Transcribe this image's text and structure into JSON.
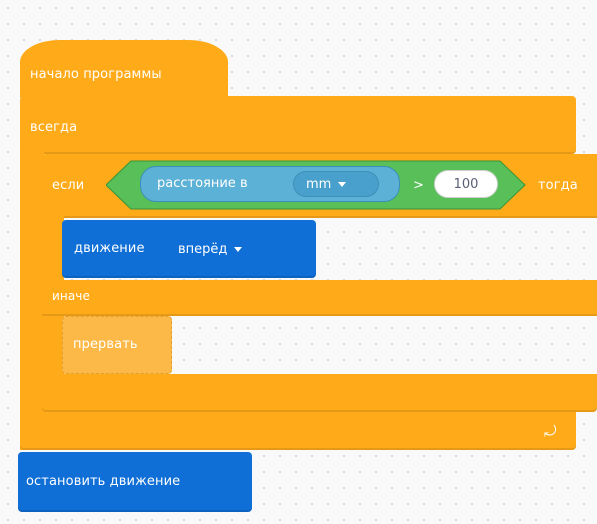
{
  "program": {
    "start_label": "начало программы",
    "forever_label": "всегда",
    "if_label": "если",
    "sensor_label": "расстояние в",
    "unit_value": "mm",
    "operator": ">",
    "threshold_value": "100",
    "then_label": "тогда",
    "move_label": "движение",
    "direction_value": "вперёд",
    "else_label": "иначе",
    "break_label": "прервать",
    "stop_label": "остановить движение"
  },
  "colors": {
    "control": "#ffab19",
    "motion": "#0f6fd6",
    "operator": "#59c059",
    "sensor": "#5cb1d6",
    "workspace": "#f9f9f9"
  }
}
